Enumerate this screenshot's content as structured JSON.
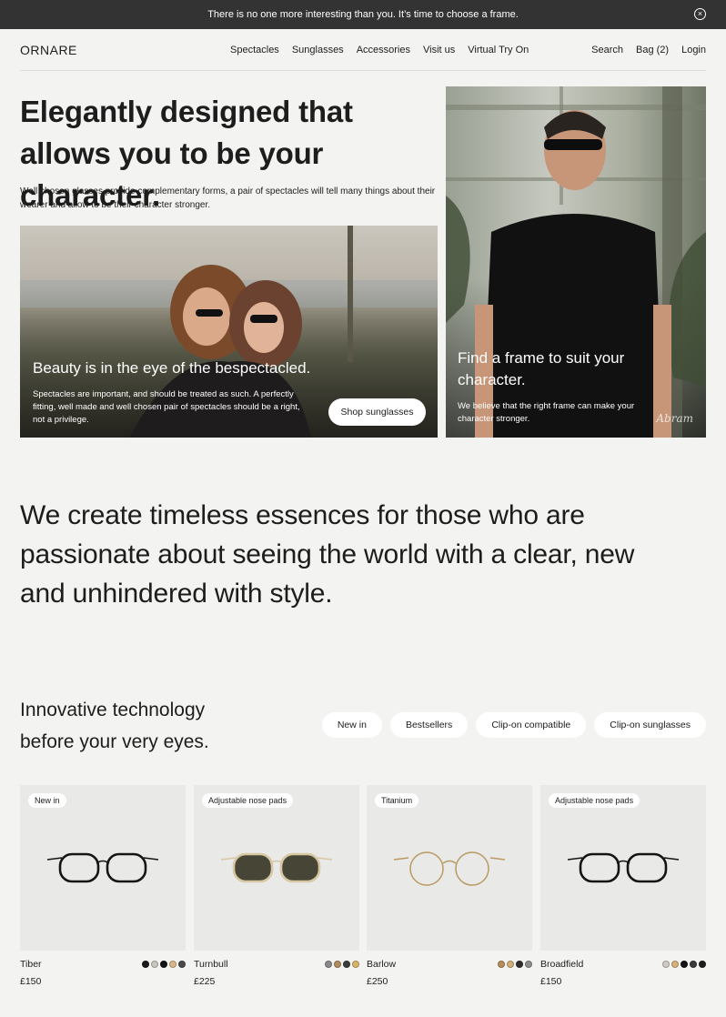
{
  "announcement": {
    "text": "There is no one more interesting than you. It’s time to choose a frame.",
    "close_icon": "×"
  },
  "header": {
    "logo": "ORNARE",
    "nav": [
      "Spectacles",
      "Sunglasses",
      "Accessories",
      "Visit us",
      "Virtual Try On"
    ],
    "utility": [
      "Search",
      "Bag (2)",
      "Login"
    ]
  },
  "hero": {
    "title": "Elegantly designed that allows you to be your character.",
    "subtitle": "Well chosen glasses provide complementary forms, a pair of spectacles will tell many things about their wearer and allow to be their character stronger.",
    "left_card": {
      "title": "Beauty is in the eye of the bespectacled.",
      "text": "Spectacles are important, and should be treated as such. A perfectly fitting, well made and well chosen pair of spectacles should be a right, not a privilege.",
      "button": "Shop sunglasses"
    },
    "right_card": {
      "title": "Find a frame to suit your character.",
      "text": "We believe that the right frame can make your character stronger.",
      "signature": "Abram"
    }
  },
  "statement": "We create timeless essences for those who are passionate about seeing the world with a clear, new and unhindered with style.",
  "section": {
    "title": "Innovative technology before your very eyes.",
    "filters": [
      "New in",
      "Bestsellers",
      "Clip-on compatible",
      "Clip-on sunglasses"
    ]
  },
  "products": [
    {
      "tag": "New in",
      "name": "Tiber",
      "price": "£150",
      "swatches": [
        "#1b1b1b",
        "#c9c6c0",
        "#141414",
        "#d9b98a",
        "#4a4a4a"
      ],
      "lens": "clear",
      "frame": "#151515"
    },
    {
      "tag": "Adjustable nose pads",
      "name": "Turnbull",
      "price": "£225",
      "swatches": [
        "#8a8a8a",
        "#b08c5e",
        "#3c3c3c",
        "#d8b46a"
      ],
      "lens": "tinted",
      "frame": "#d7c7a3"
    },
    {
      "tag": "Titanium",
      "name": "Barlow",
      "price": "£250",
      "swatches": [
        "#b58d5e",
        "#d1b07a",
        "#2e2e2e",
        "#8f8f8f"
      ],
      "lens": "clear",
      "frame": "#b99a63"
    },
    {
      "tag": "Adjustable nose pads",
      "name": "Broadfield",
      "price": "£150",
      "swatches": [
        "#cfcac2",
        "#d6b27a",
        "#141414",
        "#3a3a3a",
        "#1e1e1e"
      ],
      "lens": "clear",
      "frame": "#141414"
    }
  ]
}
